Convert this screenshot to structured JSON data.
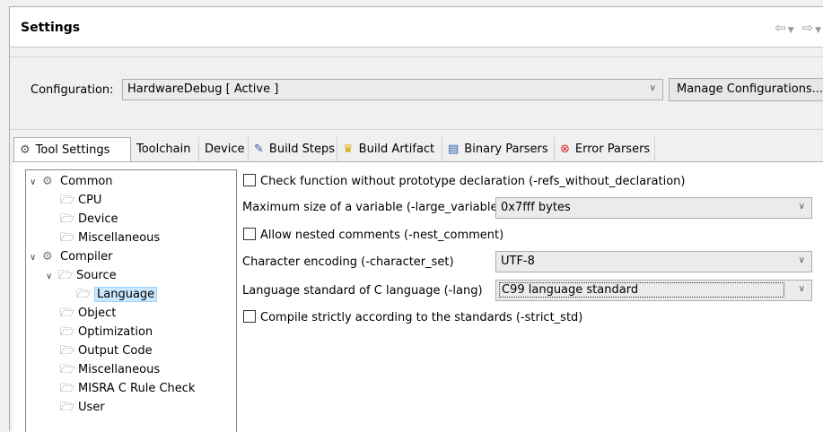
{
  "window": {
    "title": "Settings",
    "nav_back_icon": "back-arrow-icon",
    "nav_forward_icon": "forward-arrow-icon"
  },
  "config": {
    "label": "Configuration:",
    "value": "HardwareDebug  [ Active ]",
    "manage_button": "Manage Configurations..."
  },
  "tabs": [
    {
      "label": "Tool Settings",
      "icon": "gear-icon",
      "active": true
    },
    {
      "label": "Toolchain",
      "icon": "",
      "active": false
    },
    {
      "label": "Device",
      "icon": "",
      "active": false
    },
    {
      "label": "Build Steps",
      "icon": "build-steps-icon",
      "active": false
    },
    {
      "label": "Build Artifact",
      "icon": "trophy-icon",
      "active": false
    },
    {
      "label": "Binary Parsers",
      "icon": "binary-icon",
      "active": false
    },
    {
      "label": "Error Parsers",
      "icon": "error-icon",
      "active": false
    }
  ],
  "tree": [
    {
      "label": "Common",
      "expanded": true,
      "icon": "gear-icon"
    },
    {
      "label": "CPU",
      "icon": "folder-icon"
    },
    {
      "label": "Device",
      "icon": "folder-icon"
    },
    {
      "label": "Miscellaneous",
      "icon": "folder-icon"
    },
    {
      "label": "Compiler",
      "expanded": true,
      "icon": "gear-icon"
    },
    {
      "label": "Source",
      "expanded": true,
      "icon": "folder-icon"
    },
    {
      "label": "Language",
      "selected": true,
      "icon": "folder-icon"
    },
    {
      "label": "Object",
      "icon": "folder-icon"
    },
    {
      "label": "Optimization",
      "icon": "folder-icon"
    },
    {
      "label": "Output Code",
      "icon": "folder-icon"
    },
    {
      "label": "Miscellaneous",
      "icon": "folder-icon"
    },
    {
      "label": "MISRA C Rule Check",
      "icon": "folder-icon"
    },
    {
      "label": "User",
      "icon": "folder-icon"
    }
  ],
  "settings": {
    "check_func": {
      "label": "Check function without prototype declaration (-refs_without_declaration)",
      "checked": false
    },
    "max_size": {
      "label": "Maximum size of a variable (-large_variable)",
      "value": "0x7fff bytes"
    },
    "nested": {
      "label": "Allow nested comments (-nest_comment)",
      "checked": false
    },
    "encoding": {
      "label": "Character encoding (-character_set)",
      "value": "UTF-8"
    },
    "lang_std": {
      "label": "Language standard of C language (-lang)",
      "value": "C99 language standard"
    },
    "strict": {
      "label": "Compile strictly according to the standards (-strict_std)",
      "checked": false
    }
  },
  "colors": {
    "selection_bg": "#cce8ff",
    "combo_bg": "#ebebeb"
  }
}
